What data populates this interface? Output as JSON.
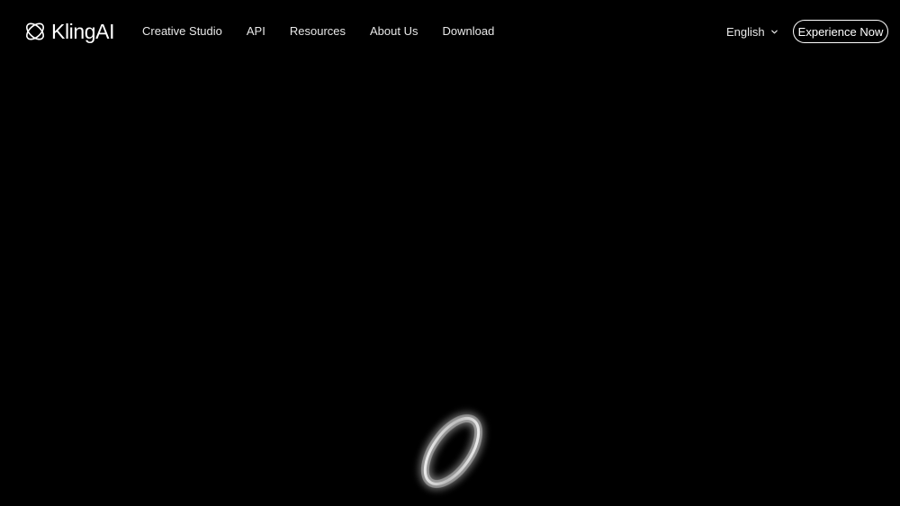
{
  "header": {
    "logo_text": "KlingAI",
    "nav": [
      {
        "label": "Creative Studio"
      },
      {
        "label": "API"
      },
      {
        "label": "Resources"
      },
      {
        "label": "About Us"
      },
      {
        "label": "Download"
      }
    ],
    "language": {
      "selected": "English",
      "icon": "chevron-down-icon"
    },
    "cta_label": "Experience Now"
  },
  "hero": {
    "visual": "glowing-ring"
  },
  "colors": {
    "background": "#000000",
    "text": "#ffffff",
    "nav_text": "#e8e8e8",
    "glow": "#ffffff"
  }
}
